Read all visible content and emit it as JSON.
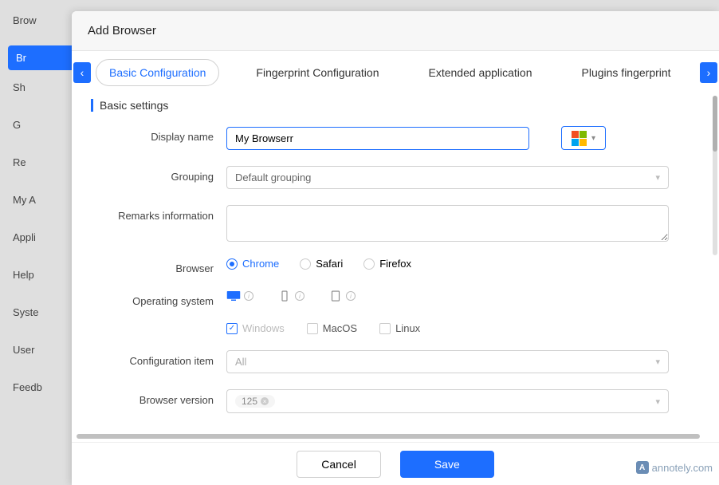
{
  "sidebar": {
    "items": [
      {
        "label": "Brow"
      },
      {
        "label": "Br"
      },
      {
        "label": "Sh"
      },
      {
        "label": "G"
      },
      {
        "label": "Re"
      },
      {
        "label": "My A"
      },
      {
        "label": "Appli"
      },
      {
        "label": "Help"
      },
      {
        "label": "Syste"
      },
      {
        "label": "User"
      },
      {
        "label": "Feedb"
      }
    ],
    "active_index": 1
  },
  "dialog": {
    "title": "Add Browser",
    "tabs": [
      {
        "label": "Basic Configuration"
      },
      {
        "label": "Fingerprint Configuration"
      },
      {
        "label": "Extended application"
      },
      {
        "label": "Plugins fingerprint"
      }
    ],
    "active_tab": 0,
    "section_title": "Basic settings",
    "labels": {
      "display_name": "Display name",
      "grouping": "Grouping",
      "remarks": "Remarks information",
      "browser": "Browser",
      "os": "Operating system",
      "config_item": "Configuration item",
      "version": "Browser version"
    },
    "values": {
      "display_name": "My Browserr",
      "grouping": "Default grouping",
      "remarks": "",
      "config_item": "All",
      "version": "125"
    },
    "browsers": [
      {
        "label": "Chrome",
        "selected": true
      },
      {
        "label": "Safari",
        "selected": false
      },
      {
        "label": "Firefox",
        "selected": false
      }
    ],
    "os_checks": [
      {
        "label": "Windows",
        "checked": true,
        "disabled": true
      },
      {
        "label": "MacOS",
        "checked": false,
        "disabled": false
      },
      {
        "label": "Linux",
        "checked": false,
        "disabled": false
      }
    ],
    "footer": {
      "cancel": "Cancel",
      "save": "Save"
    }
  },
  "watermark": "annotely.com"
}
